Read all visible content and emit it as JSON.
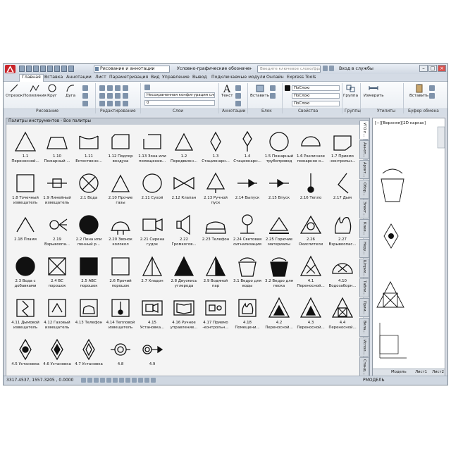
{
  "titlebar": {
    "workspace": "Рисование и аннотации",
    "doc_title": "Условно-графические обозначения п...",
    "search_placeholder": "Введите ключевое слово/фразу",
    "login": "Вход в службы"
  },
  "ribbon_tabs": [
    "Главная",
    "Вставка",
    "Аннотации",
    "Лист",
    "Параметризация",
    "Вид",
    "Управление",
    "Вывод",
    "Подключаемые модули",
    "Онлайн",
    "Express Tools"
  ],
  "ribbon": {
    "draw_buttons": [
      "Отрезок",
      "Полилиния",
      "Круг",
      "Дуга"
    ],
    "layer_state": "Несохраненная конфигурация сло",
    "layer_current": "0",
    "text_button": "Текст",
    "insert_button": "Вставить",
    "group_button": "Группа",
    "measure_button": "Измерить",
    "paste_button": "Вставить",
    "by_layer_1": "ПоСлою",
    "by_layer_2": "ПоСлою",
    "by_layer_3": "ПоСлою",
    "panels": [
      "Рисование",
      "Редактирование",
      "Слои",
      "Аннотации",
      "Блок",
      "Свойства",
      "Группы",
      "Утилиты",
      "Буфер обмена"
    ]
  },
  "palette": {
    "title": "Палитры инструментов - Все палитры",
    "tools": [
      {
        "label": "1.1\nПереносной...",
        "icon": "triangle"
      },
      {
        "label": "1.10\nПожарный ...",
        "icon": "trapezoid"
      },
      {
        "label": "1.11\nЕстественн...",
        "icon": "open-cup"
      },
      {
        "label": "1.12 Подпор\nвоздуха",
        "icon": "cut-rect"
      },
      {
        "label": "1.13 Зона или\nпомещение...",
        "icon": "bracket-rect"
      },
      {
        "label": "1.2\nПередвижн...",
        "icon": "triangle-small"
      },
      {
        "label": "1.3\nСтационарн...",
        "icon": "diamond"
      },
      {
        "label": "1.4\nСтационарн...",
        "icon": "diamond-tail"
      },
      {
        "label": "1.5 Пожарный\nтрубопровод",
        "icon": "circle"
      },
      {
        "label": "1.6 Различное\nпожарное о...",
        "icon": "semicircle"
      },
      {
        "label": "1.7 Приемо\n-контрольн...",
        "icon": "trapezoid-cut"
      },
      {
        "label": "1.8 Точечный\nизвещатель",
        "icon": "square"
      },
      {
        "label": "1.9 Линейный\nизвещатель",
        "icon": "line-box"
      },
      {
        "label": "2.1 Вода",
        "icon": "circle-x"
      },
      {
        "label": "2.10 Прочие\nгазы",
        "icon": "triangle-small"
      },
      {
        "label": "2.11 Сухой",
        "icon": "circle"
      },
      {
        "label": "2.12 Клапан",
        "icon": "bowtie"
      },
      {
        "label": "2.13 Ручной\nпуск",
        "icon": "triangle-down"
      },
      {
        "label": "2.14 Выпуск",
        "icon": "arrow-right"
      },
      {
        "label": "2.15 Впуск",
        "icon": "arrow-right-open"
      },
      {
        "label": "2.16 Тепло",
        "icon": "lollipop"
      },
      {
        "label": "2.17 Дым",
        "icon": "hook"
      },
      {
        "label": "2.18 Пламя",
        "icon": "chevron"
      },
      {
        "label": "2.19\nВзрывоопа...",
        "icon": "explosion"
      },
      {
        "label": "2.2 Пена или\nпенный р...",
        "icon": "filled-circle"
      },
      {
        "label": "2.20 Звонок\nколокол",
        "icon": "bell"
      },
      {
        "label": "2.21 Сирена\nгудок",
        "icon": "camera"
      },
      {
        "label": "2.22\nГромкогов...",
        "icon": "speaker"
      },
      {
        "label": "2.23 Телефон",
        "icon": "phone"
      },
      {
        "label": "2.24 Световая\nсигнализация",
        "icon": "light"
      },
      {
        "label": "2.25 Горючие\nматериалы",
        "icon": "triangle-bar"
      },
      {
        "label": "2.26\nОкислители",
        "icon": "triangle-circle"
      },
      {
        "label": "2.27\nВзрывоопас...",
        "icon": "flame"
      },
      {
        "label": "2.3 Вода с\nдобавками",
        "icon": "filled-circle"
      },
      {
        "label": "2.4 ВС\nпорошок",
        "icon": "square-x"
      },
      {
        "label": "2.5 АВС\nпорошок",
        "icon": "filled-square"
      },
      {
        "label": "2.6 Прочий\nпорошок",
        "icon": "square"
      },
      {
        "label": "2.7 Хладон",
        "icon": "triangle-line"
      },
      {
        "label": "2.8 Двуокись\nуглерода",
        "icon": "filled-triangle"
      },
      {
        "label": "2.9 Водяной\nпар",
        "icon": "half-triangle"
      },
      {
        "label": "3.1 Ведро для\nводы",
        "icon": "bucket"
      },
      {
        "label": "3.2 Ведро для\nпеска",
        "icon": "filled-bucket"
      },
      {
        "label": "4.1\nПереносной...",
        "icon": "triangle-x"
      },
      {
        "label": "4.10\nВодозаборн...",
        "icon": "semi-x"
      },
      {
        "label": "4.11 Дымовой\nизвещатель",
        "icon": "zigzag"
      },
      {
        "label": "4.12 Газовый\nизвещатель",
        "icon": "box-chevron"
      },
      {
        "label": "4.13 Телефон",
        "icon": "box-phone"
      },
      {
        "label": "4.14 Тепловой\nизвещатель",
        "icon": "box-lollipop"
      },
      {
        "label": "4.15\nУстановка...",
        "icon": "box-camera"
      },
      {
        "label": "4.16 Ручное\nуправление...",
        "icon": "box-book"
      },
      {
        "label": "4.17 Приемо\n-контрольн...",
        "icon": "box-device"
      },
      {
        "label": "4.18\nПомещени...",
        "icon": "box-flame"
      },
      {
        "label": "4.2\nПереносной...",
        "icon": "triangle-filled-inner"
      },
      {
        "label": "4.3\nПереносной...",
        "icon": "triangle-filled-inner2"
      },
      {
        "label": "4.4\nПереносной...",
        "icon": "triangle-box-x"
      },
      {
        "label": "4.5 Установка",
        "icon": "diamond-dot"
      },
      {
        "label": "4.6 Установка",
        "icon": "diamond-arrow"
      },
      {
        "label": "4.7 Установка",
        "icon": "diamond-double"
      },
      {
        "label": "4.8",
        "icon": "ring-dot"
      },
      {
        "label": "4.9",
        "icon": "ring-arrow"
      }
    ],
    "side_tabs": [
      "УГО п...",
      "Аннот...",
      "Архит...",
      "Обор...",
      "Элект...",
      "Клеи...",
      "Неру...",
      "Штрих...",
      "Табли...",
      "Прим...",
      "Вкла...",
      "Испол...",
      "Станд..."
    ]
  },
  "viewport": {
    "label": "[−][Верхняя][2D каркас]",
    "model_tab": "Модель",
    "layout1_tab": "Лист1",
    "layout2_tab": "Лист2"
  },
  "status": {
    "coordinates": "3317.4537, 1557.3205 , 0.0000",
    "model_label": "РМОДЕЛЬ"
  }
}
